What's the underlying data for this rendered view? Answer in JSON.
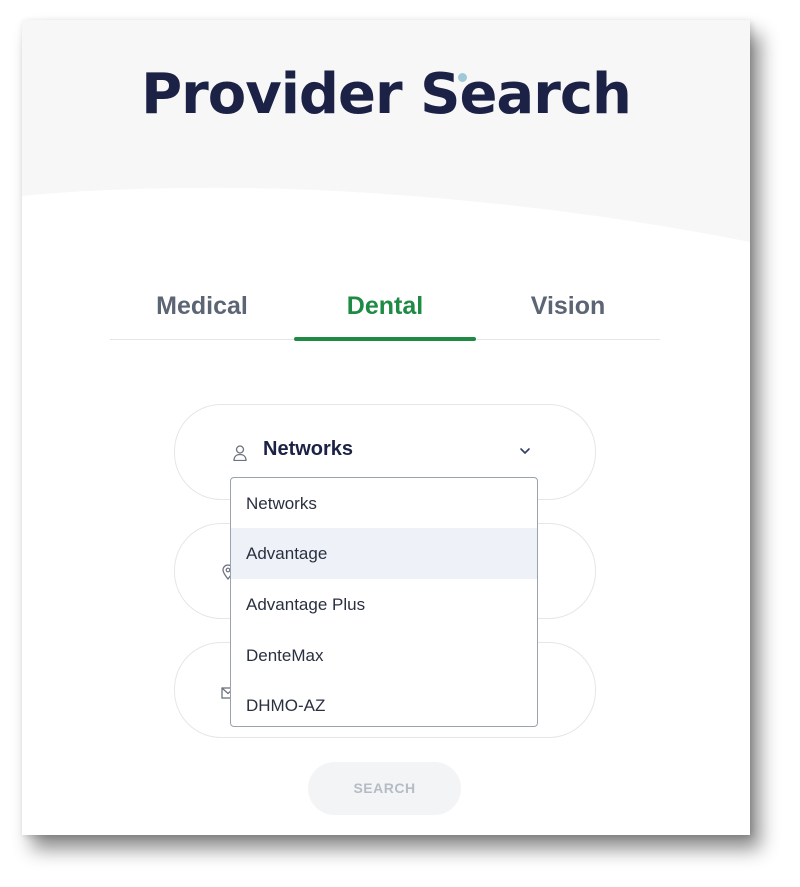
{
  "header": {
    "title": "Provider Search"
  },
  "tabs": [
    {
      "label": "Medical",
      "active": false
    },
    {
      "label": "Dental",
      "active": true
    },
    {
      "label": "Vision",
      "active": false
    }
  ],
  "fields": {
    "networks": {
      "icon": "person-icon",
      "selected": "Networks"
    },
    "location": {
      "icon": "location-pin-icon"
    },
    "email": {
      "icon": "envelope-icon"
    }
  },
  "dropdown": {
    "options": [
      "Networks",
      "Advantage",
      "Advantage Plus",
      "DenteMax",
      "DHMO-AZ"
    ],
    "highlighted_index": 1
  },
  "search_button": {
    "label": "SEARCH"
  },
  "colors": {
    "brand_dark": "#1c2245",
    "accent_green": "#1f8a43",
    "tab_inactive": "#5b6573",
    "highlight": "#eef2f8"
  }
}
